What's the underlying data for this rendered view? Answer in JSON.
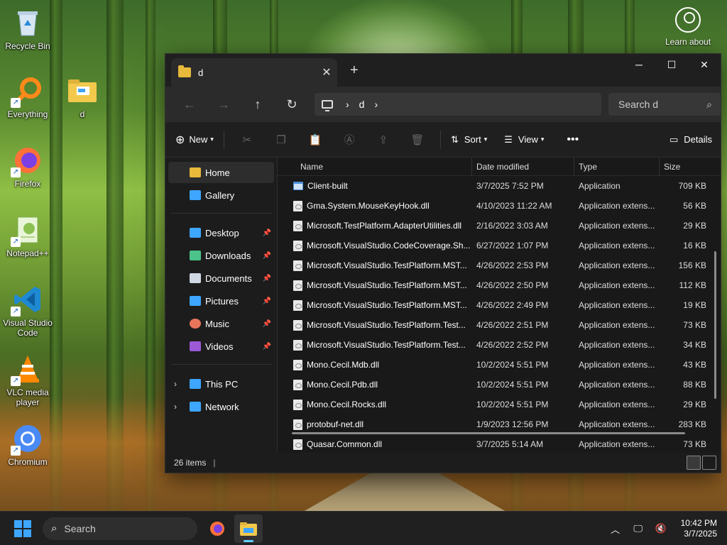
{
  "desktop": {
    "icons": [
      {
        "label": "Recycle Bin"
      },
      {
        "label": "Everything"
      },
      {
        "label": "d"
      },
      {
        "label": "Firefox"
      },
      {
        "label": "Notepad++"
      },
      {
        "label": "Visual Studio Code"
      },
      {
        "label": "VLC media player"
      },
      {
        "label": "Chromium"
      }
    ],
    "learn_about": "Learn about"
  },
  "window": {
    "tab_title": "d",
    "address_segments": [
      "d"
    ],
    "search_placeholder": "Search d",
    "toolbar": {
      "new_label": "New",
      "sort_label": "Sort",
      "view_label": "View",
      "details_label": "Details"
    },
    "sidebar": [
      {
        "label": "Home",
        "icon": "home-icon",
        "color": "#e8b93a",
        "selected": true
      },
      {
        "label": "Gallery",
        "icon": "gallery-icon",
        "color": "#3ea6ff"
      },
      {
        "label": "Desktop",
        "icon": "desktop-icon",
        "color": "#3ea6ff",
        "pinned": true
      },
      {
        "label": "Downloads",
        "icon": "downloads-icon",
        "color": "#4cc38a",
        "pinned": true
      },
      {
        "label": "Documents",
        "icon": "documents-icon",
        "color": "#cfd8e3",
        "pinned": true
      },
      {
        "label": "Pictures",
        "icon": "pictures-icon",
        "color": "#3ea6ff",
        "pinned": true
      },
      {
        "label": "Music",
        "icon": "music-icon",
        "color": "#e8745a",
        "pinned": true
      },
      {
        "label": "Videos",
        "icon": "videos-icon",
        "color": "#9b59d6",
        "pinned": true
      },
      {
        "label": "This PC",
        "icon": "this-pc-icon",
        "color": "#3ea6ff"
      },
      {
        "label": "Network",
        "icon": "network-icon",
        "color": "#3ea6ff"
      }
    ],
    "columns": {
      "name": "Name",
      "date": "Date modified",
      "type": "Type",
      "size": "Size"
    },
    "files": [
      {
        "name": "Client-built",
        "date": "3/7/2025 7:52 PM",
        "type": "Application",
        "size": "709 KB",
        "kind": "app"
      },
      {
        "name": "Gma.System.MouseKeyHook.dll",
        "date": "4/10/2023 11:22 AM",
        "type": "Application extens...",
        "size": "56 KB",
        "kind": "dll"
      },
      {
        "name": "Microsoft.TestPlatform.AdapterUtilities.dll",
        "date": "2/16/2022 3:03 AM",
        "type": "Application extens...",
        "size": "29 KB",
        "kind": "dll"
      },
      {
        "name": "Microsoft.VisualStudio.CodeCoverage.Sh...",
        "date": "6/27/2022 1:07 PM",
        "type": "Application extens...",
        "size": "16 KB",
        "kind": "dll"
      },
      {
        "name": "Microsoft.VisualStudio.TestPlatform.MST...",
        "date": "4/26/2022 2:53 PM",
        "type": "Application extens...",
        "size": "156 KB",
        "kind": "dll"
      },
      {
        "name": "Microsoft.VisualStudio.TestPlatform.MST...",
        "date": "4/26/2022 2:50 PM",
        "type": "Application extens...",
        "size": "112 KB",
        "kind": "dll"
      },
      {
        "name": "Microsoft.VisualStudio.TestPlatform.MST...",
        "date": "4/26/2022 2:49 PM",
        "type": "Application extens...",
        "size": "19 KB",
        "kind": "dll"
      },
      {
        "name": "Microsoft.VisualStudio.TestPlatform.Test...",
        "date": "4/26/2022 2:51 PM",
        "type": "Application extens...",
        "size": "73 KB",
        "kind": "dll"
      },
      {
        "name": "Microsoft.VisualStudio.TestPlatform.Test...",
        "date": "4/26/2022 2:52 PM",
        "type": "Application extens...",
        "size": "34 KB",
        "kind": "dll"
      },
      {
        "name": "Mono.Cecil.Mdb.dll",
        "date": "10/2/2024 5:51 PM",
        "type": "Application extens...",
        "size": "43 KB",
        "kind": "dll"
      },
      {
        "name": "Mono.Cecil.Pdb.dll",
        "date": "10/2/2024 5:51 PM",
        "type": "Application extens...",
        "size": "88 KB",
        "kind": "dll"
      },
      {
        "name": "Mono.Cecil.Rocks.dll",
        "date": "10/2/2024 5:51 PM",
        "type": "Application extens...",
        "size": "29 KB",
        "kind": "dll"
      },
      {
        "name": "protobuf-net.dll",
        "date": "1/9/2023 12:56 PM",
        "type": "Application extens...",
        "size": "283 KB",
        "kind": "dll"
      },
      {
        "name": "Quasar.Common.dll",
        "date": "3/7/2025 5:14 AM",
        "type": "Application extens...",
        "size": "73 KB",
        "kind": "dll"
      }
    ],
    "status": "26 items"
  },
  "taskbar": {
    "search_placeholder": "Search",
    "time": "10:42 PM",
    "date": "3/7/2025"
  }
}
